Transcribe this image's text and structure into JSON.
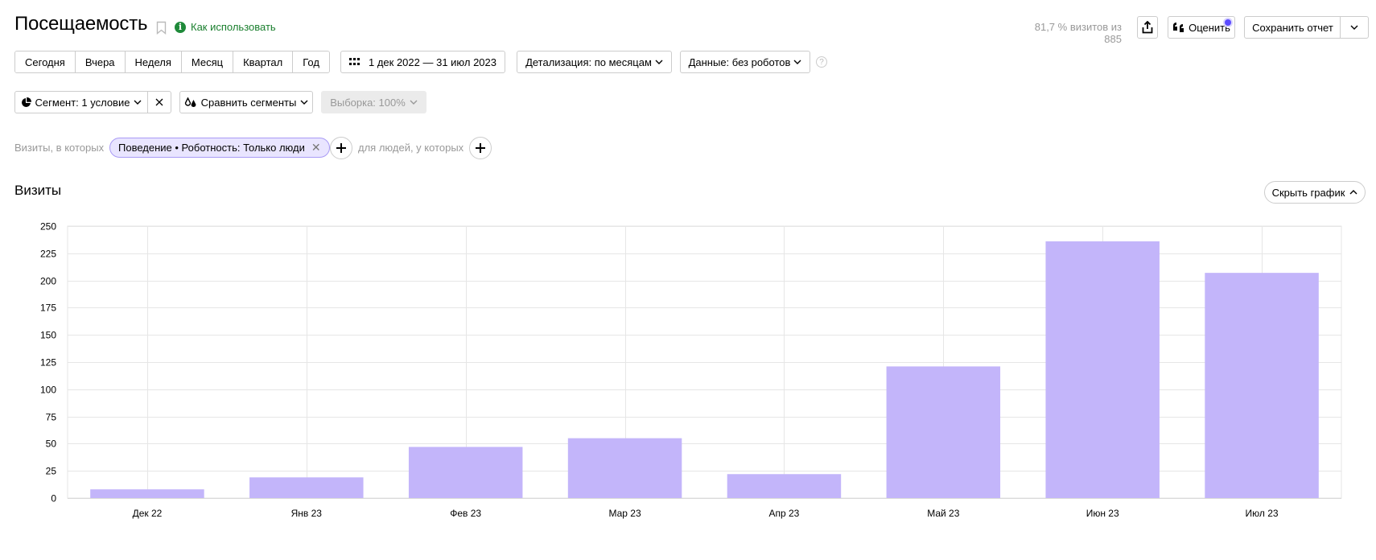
{
  "header": {
    "title": "Посещаемость",
    "howto_label": "Как использовать",
    "visits_share": "81,7 % визитов из 885",
    "rate_label": "Оценить",
    "save_label": "Сохранить отчет"
  },
  "periods": [
    "Сегодня",
    "Вчера",
    "Неделя",
    "Месяц",
    "Квартал",
    "Год"
  ],
  "toolbar": {
    "date_range": "1 дек 2022 — 31 июл 2023",
    "detail": "Детализация: по месяцам",
    "data": "Данные: без роботов",
    "help": "?"
  },
  "segments": {
    "segment_label": "Сегмент: 1 условие",
    "compare_label": "Сравнить сегменты",
    "sample_label": "Выборка: 100%"
  },
  "filter": {
    "visits_in": "Визиты, в которых",
    "chip_label": "Поведение • Роботность: Только люди",
    "people_label": "для людей, у которых"
  },
  "chart_section": {
    "title": "Визиты",
    "hide_label": "Скрыть график"
  },
  "chart_data": {
    "type": "bar",
    "categories": [
      "Дек 22",
      "Янв 23",
      "Фев 23",
      "Мар 23",
      "Апр 23",
      "Май 23",
      "Июн 23",
      "Июл 23"
    ],
    "values": [
      8,
      19,
      47,
      55,
      22,
      121,
      236,
      207
    ],
    "ylim": [
      0,
      250
    ],
    "yticks": [
      0,
      25,
      50,
      75,
      100,
      125,
      150,
      175,
      200,
      225,
      250
    ],
    "grid": true,
    "bar_color": "#c3b5fa"
  },
  "colors": {
    "accent_green": "#1a7f2e",
    "chip_bg": "#e9e5ff",
    "bar": "#c3b5fa"
  }
}
